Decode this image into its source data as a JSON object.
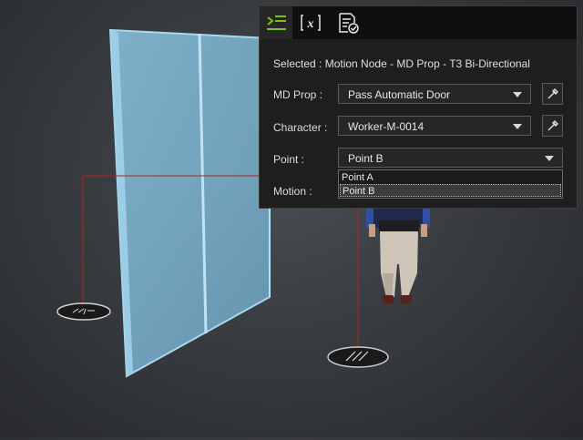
{
  "panel": {
    "tabs": [
      {
        "icon": "node-tree-icon",
        "active": true
      },
      {
        "icon": "variable-x-icon",
        "active": false
      },
      {
        "icon": "checklist-icon",
        "active": false
      }
    ],
    "selected_text": "Selected : Motion Node - MD Prop - T3 Bi-Directional",
    "md_prop": {
      "label": "MD Prop :",
      "value": "Pass Automatic Door"
    },
    "character": {
      "label": "Character :",
      "value": "Worker-M-0014"
    },
    "point": {
      "label": "Point :",
      "value": "Point B",
      "options": [
        "Point A",
        "Point B"
      ],
      "highlighted": "Point B"
    },
    "motion": {
      "label": "Motion :"
    }
  },
  "colors": {
    "accent": "#7cc21f",
    "connector": "#b82020",
    "door": "#7fb9d8",
    "panel_bg": "#1e1e1e"
  }
}
